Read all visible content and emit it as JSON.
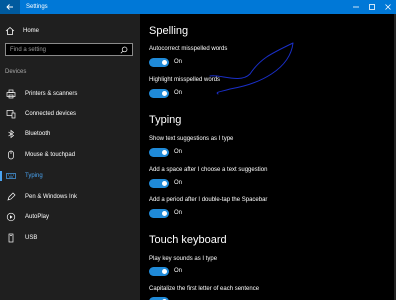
{
  "window": {
    "title": "Settings"
  },
  "sidebar": {
    "home_label": "Home",
    "search_placeholder": "Find a setting",
    "section_label": "Devices",
    "items": [
      {
        "label": "Printers & scanners",
        "icon": "printer-icon"
      },
      {
        "label": "Connected devices",
        "icon": "connected-devices-icon"
      },
      {
        "label": "Bluetooth",
        "icon": "bluetooth-icon"
      },
      {
        "label": "Mouse & touchpad",
        "icon": "mouse-icon"
      },
      {
        "label": "Typing",
        "icon": "keyboard-icon",
        "active": true
      },
      {
        "label": "Pen & Windows Ink",
        "icon": "pen-icon"
      },
      {
        "label": "AutoPlay",
        "icon": "autoplay-icon"
      },
      {
        "label": "USB",
        "icon": "usb-icon"
      }
    ]
  },
  "content": {
    "spelling_heading": "Spelling",
    "typing_heading": "Typing",
    "touch_heading": "Touch keyboard",
    "options": [
      {
        "label": "Autocorrect misspelled words",
        "state": "On"
      },
      {
        "label": "Highlight misspelled words",
        "state": "On"
      },
      {
        "label": "Show text suggestions as I type",
        "state": "On"
      },
      {
        "label": "Add a space after I choose a text suggestion",
        "state": "On"
      },
      {
        "label": "Add a period after I double-tap the Spacebar",
        "state": "On"
      },
      {
        "label": "Play key sounds as I type",
        "state": "On"
      },
      {
        "label": "Capitalize the first letter of each sentence",
        "state": "On"
      }
    ]
  },
  "colors": {
    "accent": "#0078d7",
    "toggle_on": "#1f8ad8",
    "ink": "#1a2fc8"
  }
}
